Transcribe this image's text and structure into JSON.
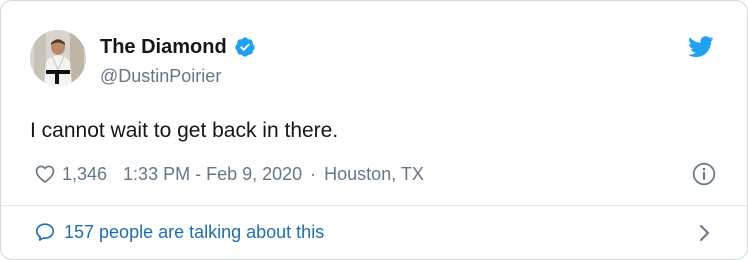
{
  "tweet": {
    "display_name": "The Diamond",
    "handle": "@DustinPoirier",
    "text": "I cannot wait to get back in there.",
    "likes": "1,346",
    "timestamp": "1:33 PM - Feb 9, 2020",
    "separator": "·",
    "location": "Houston, TX",
    "verified": true
  },
  "footer": {
    "conversation_text": "157 people are talking about this"
  },
  "icons": {
    "avatar": "avatar-photo",
    "verified": "verified-badge-icon",
    "brand": "twitter-bird-icon",
    "like": "heart-icon",
    "info": "info-icon",
    "conversation": "speech-bubble-icon",
    "more": "chevron-right-icon"
  },
  "colors": {
    "brand_blue": "#1da1f2",
    "link_blue": "#1b6fb3",
    "secondary_text": "#657786",
    "primary_text": "#14171a",
    "border": "#cfd9de"
  }
}
